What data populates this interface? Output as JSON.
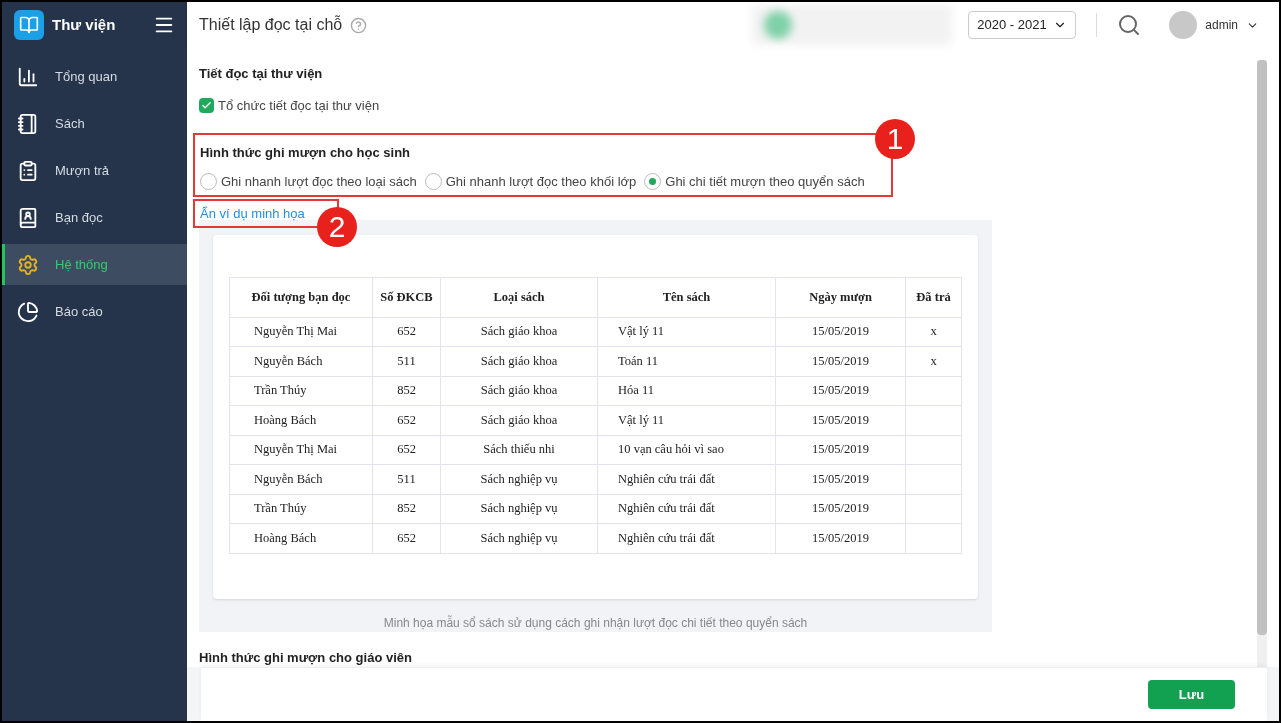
{
  "sidebar": {
    "title": "Thư viện",
    "items": [
      {
        "label": "Tổng quan",
        "selected": false
      },
      {
        "label": "Sách",
        "selected": false
      },
      {
        "label": "Mượn trả",
        "selected": false
      },
      {
        "label": "Bạn đọc",
        "selected": false
      },
      {
        "label": "Hệ thống",
        "selected": true
      },
      {
        "label": "Báo cáo",
        "selected": false
      }
    ]
  },
  "header": {
    "title": "Thiết lập đọc tại chỗ",
    "year": "2020 - 2021",
    "user": "admin"
  },
  "reading_period": {
    "title": "Tiết đọc tại thư viện",
    "checkbox": {
      "label": "Tổ chức tiết đọc tại thư viện",
      "checked": true
    }
  },
  "student_mode": {
    "title": "Hình thức ghi mượn cho học sinh",
    "annotation": "1",
    "options": [
      {
        "label": "Ghi nhanh lượt đọc theo loại sách",
        "selected": false
      },
      {
        "label": "Ghi nhanh lượt đọc theo khối lớp",
        "selected": false
      },
      {
        "label": "Ghi chi tiết mượn theo quyển sách",
        "selected": true
      }
    ]
  },
  "toggle_link": {
    "label": "Ẩn ví dụ minh họa",
    "annotation": "2"
  },
  "example": {
    "columns": [
      "Đối tượng bạn đọc",
      "Số ĐKCB",
      "Loại sách",
      "Tên sách",
      "Ngày mượn",
      "Đã trả"
    ],
    "rows": [
      [
        "Nguyễn Thị Mai",
        "652",
        "Sách giáo khoa",
        "Vật lý 11",
        "15/05/2019",
        "x"
      ],
      [
        "Nguyễn Bách",
        "511",
        "Sách giáo khoa",
        "Toán 11",
        "15/05/2019",
        "x"
      ],
      [
        "Trần Thúy",
        "852",
        "Sách giáo khoa",
        "Hóa 11",
        "15/05/2019",
        ""
      ],
      [
        "Hoàng Bách",
        "652",
        "Sách giáo khoa",
        "Vật lý 11",
        "15/05/2019",
        ""
      ],
      [
        "Nguyễn Thị Mai",
        "652",
        "Sách thiếu nhi",
        "10 vạn câu hỏi vì sao",
        "15/05/2019",
        ""
      ],
      [
        "Nguyễn Bách",
        "511",
        "Sách nghiệp vụ",
        "Nghiên cứu trái đất",
        "15/05/2019",
        ""
      ],
      [
        "Trần Thúy",
        "852",
        "Sách nghiệp vụ",
        "Nghiên cứu trái đất",
        "15/05/2019",
        ""
      ],
      [
        "Hoàng Bách",
        "652",
        "Sách nghiệp vụ",
        "Nghiên cứu trái đất",
        "15/05/2019",
        ""
      ]
    ],
    "caption": "Minh họa mẫu sổ sách sử dụng cách ghi nhận lượt đọc chi tiết theo quyển sách"
  },
  "teacher_mode": {
    "title": "Hình thức ghi mượn cho giáo viên"
  },
  "save_button": "Lưu"
}
